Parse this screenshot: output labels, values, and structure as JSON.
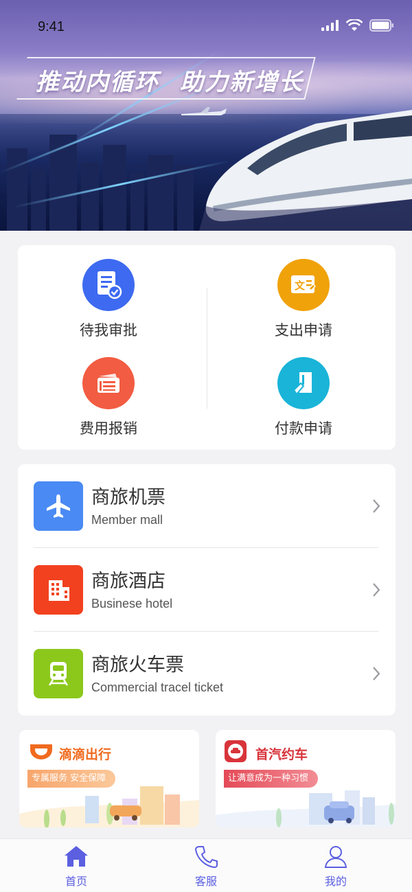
{
  "status_bar": {
    "time": "9:41"
  },
  "banner": {
    "slogan_part1": "推动内循环",
    "slogan_part2": "助力新增长"
  },
  "quick_actions": [
    {
      "label": "待我审批",
      "icon": "document-check-icon",
      "color": "#3d6af0"
    },
    {
      "label": "支出申请",
      "icon": "text-edit-icon",
      "color": "#f0a20a"
    },
    {
      "label": "费用报销",
      "icon": "receipt-cards-icon",
      "color": "#f25c42"
    },
    {
      "label": "付款申请",
      "icon": "payment-doc-icon",
      "color": "#19b4d8"
    }
  ],
  "travel_services": [
    {
      "title": "商旅机票",
      "subtitle": "Member mall",
      "icon": "airplane-icon",
      "color": "#4a8af4"
    },
    {
      "title": "商旅酒店",
      "subtitle": "Businese hotel",
      "icon": "hotel-icon",
      "color": "#f2411f"
    },
    {
      "title": "商旅火车票",
      "subtitle": "Commercial tracel ticket",
      "icon": "train-icon",
      "color": "#8cc81c"
    }
  ],
  "partners": [
    {
      "name": "滴滴出行",
      "tag": "专属服务 安全保障",
      "name_color": "#f06a1e",
      "tag_color": "#f7a56b",
      "icon": "didi-logo-icon"
    },
    {
      "name": "首汽约车",
      "tag": "让满意成为一种习惯",
      "name_color": "#d8343a",
      "tag_color": "#e44a57",
      "icon": "shouqi-logo-icon"
    }
  ],
  "tabbar": [
    {
      "label": "首页",
      "icon": "home-icon"
    },
    {
      "label": "客服",
      "icon": "phone-icon"
    },
    {
      "label": "我的",
      "icon": "user-icon"
    }
  ],
  "accent_color": "#5b5fe0"
}
